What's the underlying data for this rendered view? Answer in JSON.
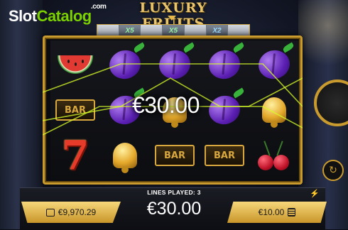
{
  "watermark": {
    "part1": "Slot",
    "part2": "Catalog",
    "suffix": ".com"
  },
  "game_title": "LUXURY FRUITS",
  "multipliers": [
    {
      "label": "",
      "active": false
    },
    {
      "label": "X5",
      "active": true
    },
    {
      "label": "",
      "active": false
    },
    {
      "label": "X5",
      "active": true
    },
    {
      "label": "",
      "active": false
    },
    {
      "label": "X2",
      "active": true
    },
    {
      "label": "",
      "active": false
    }
  ],
  "reels": [
    [
      "watermelon",
      "bar",
      "seven"
    ],
    [
      "plum",
      "plum",
      "bell"
    ],
    [
      "plum",
      "bell",
      "bar"
    ],
    [
      "plum",
      "plum",
      "bar"
    ],
    [
      "plum",
      "bell",
      "cherries"
    ]
  ],
  "bar_label": "BAR",
  "win_overlay": "€30.00",
  "lines_played": "LINES PLAYED: 3",
  "total_win": "€30.00",
  "balance": "€9,970.29",
  "bet": "€10.00",
  "colors": {
    "gold": "#c99a2e",
    "plum": "#5b1fb2",
    "win_line": "#d8ff2a"
  }
}
